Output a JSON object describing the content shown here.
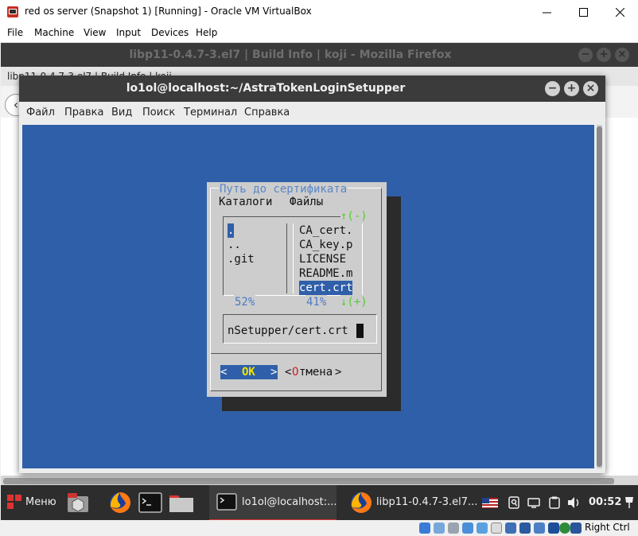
{
  "host_window": {
    "title": "red os server (Snapshot 1) [Running] - Oracle VM VirtualBox",
    "menu": [
      "File",
      "Machine",
      "View",
      "Input",
      "Devices",
      "Help"
    ],
    "host_key": "Right Ctrl"
  },
  "firefox": {
    "title": "libp11-0.4.7-3.el7 | Build Info | koji - Mozilla Firefox",
    "tab_text": "libp11-0.4.7-3.el7 | Build Info | koji"
  },
  "terminal": {
    "title": "lo1ol@localhost:~/AstraTokenLoginSetupper",
    "menu": [
      "Файл",
      "Правка",
      "Вид",
      "Поиск",
      "Терминал",
      "Справка"
    ]
  },
  "dialog": {
    "title": "Путь до сертификата",
    "dirs_header": "Каталоги",
    "files_header": "Файлы",
    "dirs": [
      ".",
      "..",
      ".git"
    ],
    "files": [
      "CA_cert.",
      "CA_key.p",
      "LICENSE",
      "README.m",
      "cert.crt"
    ],
    "selected_dir": ".",
    "selected_file": "cert.crt",
    "dirs_percent": "52%",
    "files_percent": "41%",
    "scroll_up": "↑(-)",
    "scroll_down": "↓(+)",
    "path_value": "nSetupper/cert.crt",
    "ok_left": "<",
    "ok_label": "OK",
    "ok_right": ">",
    "cancel_open": "<",
    "cancel_hotkey": "О",
    "cancel_rest": "тмена",
    "cancel_close": ">"
  },
  "taskbar": {
    "menu_label": "Меню",
    "terminal_task": "lo1ol@localhost:...",
    "firefox_task": "libp11-0.4.7-3.el7...",
    "clock": "00:52"
  },
  "colors": {
    "terminal_bg": "#2f5fa8",
    "dialog_bg": "#cdcdcd",
    "dialog_title": "#5b87c7",
    "selection": "#2f5fa8",
    "scroll_hint": "#55cc33",
    "cancel_hotkey": "#cc2222",
    "ok_hotkey": "#f2e500"
  }
}
